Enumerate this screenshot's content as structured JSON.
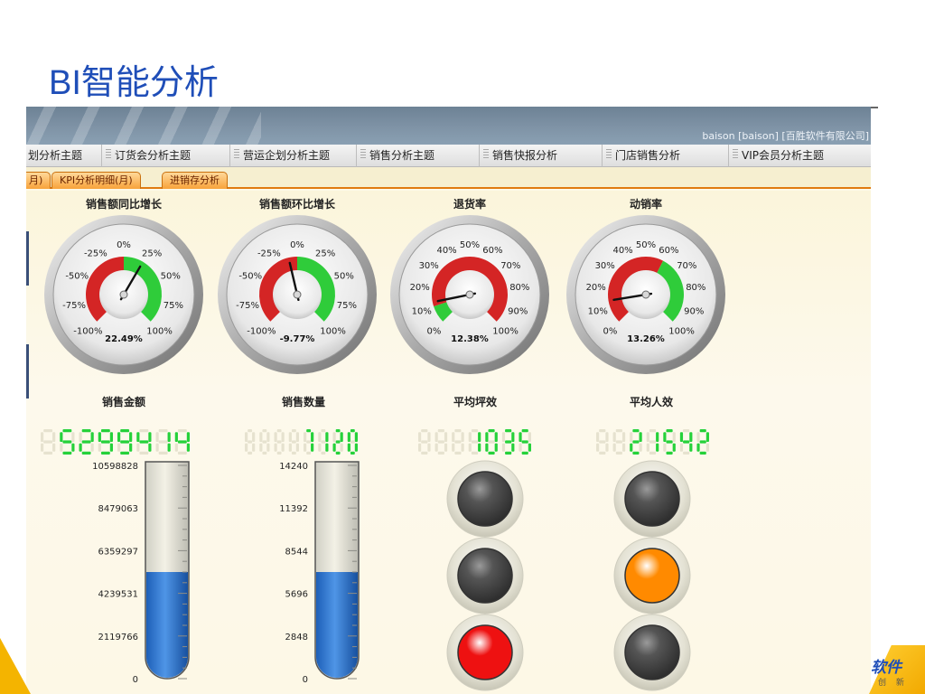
{
  "slide": {
    "title": "BI智能分析"
  },
  "logo": {
    "text": "软件",
    "sub": "创 新"
  },
  "app": {
    "user_info": "baison [baison] [百胜软件有限公司]",
    "main_tabs": [
      {
        "label": "划分析主题"
      },
      {
        "label": "订货会分析主题"
      },
      {
        "label": "营运企划分析主题"
      },
      {
        "label": "销售分析主题"
      },
      {
        "label": "销售快报分析"
      },
      {
        "label": "门店销售分析"
      },
      {
        "label": "VIP会员分析主题"
      }
    ],
    "sub_tabs": [
      {
        "label": "月)"
      },
      {
        "label": "KPI分析明细(月)"
      },
      {
        "label": "进销存分析"
      }
    ]
  },
  "gauges": [
    {
      "title": "销售额同比增长",
      "readout": "22.49%",
      "value": 22.49,
      "min": -100,
      "max": 100,
      "ticks": [
        "-100%",
        "-75%",
        "-50%",
        "-25%",
        "0%",
        "25%",
        "50%",
        "75%",
        "100%"
      ],
      "color_low": "#d42525",
      "color_high": "#2fcc3a",
      "split": 0
    },
    {
      "title": "销售额环比增长",
      "readout": "-9.77%",
      "value": -9.77,
      "min": -100,
      "max": 100,
      "ticks": [
        "-100%",
        "-75%",
        "-50%",
        "-25%",
        "0%",
        "25%",
        "50%",
        "75%",
        "100%"
      ],
      "color_low": "#d42525",
      "color_high": "#2fcc3a",
      "split": 0
    },
    {
      "title": "退货率",
      "readout": "12.38%",
      "value": 12.38,
      "min": 0,
      "max": 100,
      "ticks": [
        "0%",
        "10%",
        "20%",
        "30%",
        "40%",
        "50%",
        "60%",
        "70%",
        "80%",
        "90%",
        "100%"
      ],
      "color_low": "#2fcc3a",
      "color_high": "#d42525",
      "split": 10
    },
    {
      "title": "动销率",
      "readout": "13.26%",
      "value": 13.26,
      "min": 0,
      "max": 100,
      "ticks": [
        "0%",
        "10%",
        "20%",
        "30%",
        "40%",
        "50%",
        "60%",
        "70%",
        "80%",
        "90%",
        "100%"
      ],
      "color_low": "#d42525",
      "color_high": "#2fcc3a",
      "split": 60
    }
  ],
  "kpis": [
    {
      "title": "销售金额",
      "display": "5299414",
      "digits": 8
    },
    {
      "title": "销售数量",
      "display": "7120",
      "digits": 8
    },
    {
      "title": "平均坪效",
      "display": "1035",
      "digits": 7
    },
    {
      "title": "平均人效",
      "display": "21542",
      "digits": 7
    }
  ],
  "tubes": [
    {
      "ticks": [
        "10598828",
        "8479063",
        "6359297",
        "4239531",
        "2119766",
        "0"
      ],
      "max": 10598828,
      "value": 5299414
    },
    {
      "ticks": [
        "14240",
        "11392",
        "8544",
        "5696",
        "2848",
        "0"
      ],
      "max": 14240,
      "value": 7120
    }
  ],
  "lights": [
    {
      "states": [
        "off",
        "off",
        "red"
      ],
      "colors": {
        "off": "#555555",
        "red": "#ee1111",
        "orange": "#ff8a00"
      }
    },
    {
      "states": [
        "off",
        "orange",
        "off"
      ],
      "colors": {
        "off": "#555555",
        "red": "#ee1111",
        "orange": "#ff8a00"
      }
    }
  ]
}
